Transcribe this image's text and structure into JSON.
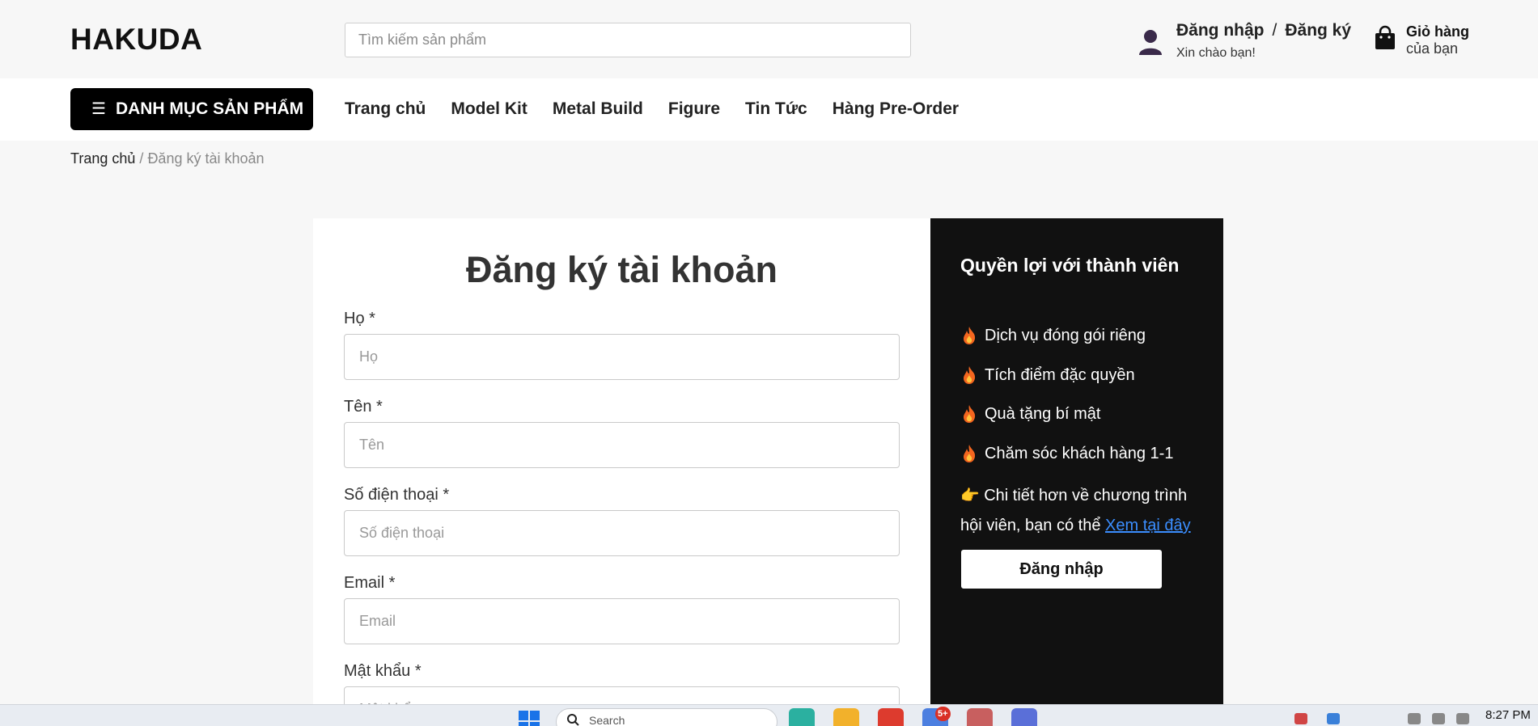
{
  "header": {
    "logo": "HAKUDA",
    "search_placeholder": "Tìm kiếm sản phẩm",
    "account": {
      "login": "Đăng nhập",
      "separator": "/",
      "register": "Đăng ký",
      "greeting": "Xin chào bạn!"
    },
    "cart": {
      "title": "Giỏ hàng",
      "subtitle": "của bạn"
    }
  },
  "nav": {
    "category_button": "DANH MỤC SẢN PHẨM",
    "links": [
      "Trang chủ",
      "Model Kit",
      "Metal Build",
      "Figure",
      "Tin Tức",
      "Hàng Pre-Order"
    ]
  },
  "breadcrumb": {
    "home": "Trang chủ",
    "separator": "/",
    "current": "Đăng ký tài khoản"
  },
  "form": {
    "title": "Đăng ký tài khoản",
    "fields": [
      {
        "label": "Họ *",
        "placeholder": "Họ"
      },
      {
        "label": "Tên *",
        "placeholder": "Tên"
      },
      {
        "label": "Số điện thoại *",
        "placeholder": "Số điện thoại"
      },
      {
        "label": "Email *",
        "placeholder": "Email"
      },
      {
        "label": "Mật khẩu *",
        "placeholder": "Mật khẩu"
      }
    ]
  },
  "benefits": {
    "title": "Quyền lợi với thành viên",
    "items": [
      "Dịch vụ đóng gói riêng",
      "Tích điểm đặc quyền",
      "Quà tặng bí mật",
      "Chăm sóc khách hàng 1-1"
    ],
    "note_icon": "👉",
    "note_text": "Chi tiết hơn về chương trình hội viên, bạn có thể ",
    "note_link": "Xem tại đây",
    "login_button": "Đăng nhập",
    "link_color": "#3b8eff"
  },
  "taskbar": {
    "search_text": "Search",
    "badge_count": "5+",
    "time": "8:27 PM"
  }
}
